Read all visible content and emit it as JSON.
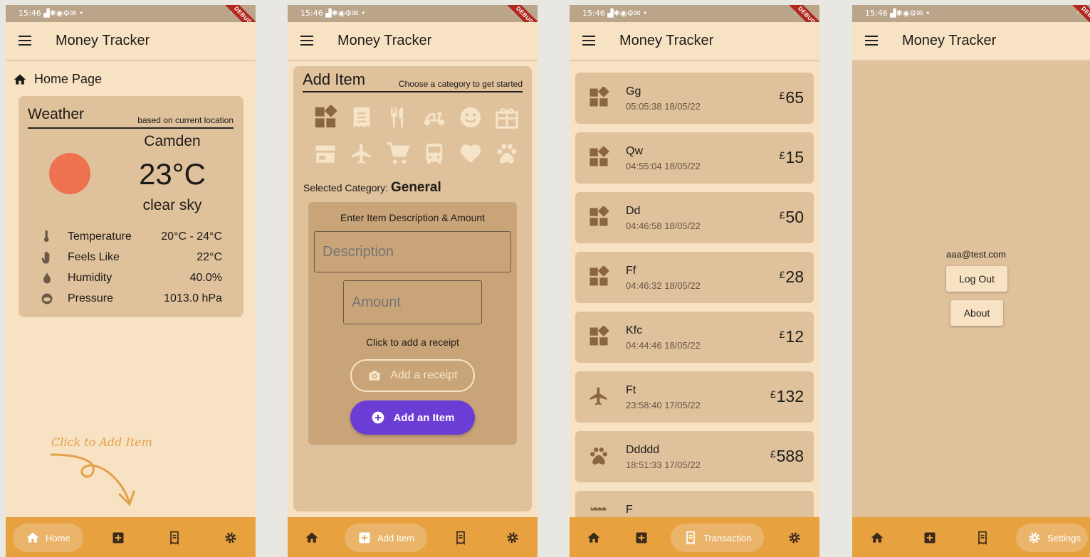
{
  "status_bar": {
    "time": "15:46",
    "icons_left": "▟✱◉⚙✉ •"
  },
  "app": {
    "title": "Money Tracker",
    "debug_label": "DEBUG"
  },
  "nav": {
    "home": "Home",
    "add_item": "Add Item",
    "transaction": "Transaction",
    "settings": "Settings"
  },
  "home": {
    "crumb": "Home Page",
    "weather": {
      "title": "Weather",
      "subtitle": "based on current location",
      "city": "Camden",
      "temp": "23°C",
      "description": "clear sky",
      "rows": [
        {
          "label": "Temperature",
          "value": "20°C - 24°C",
          "icon": "thermometer-icon"
        },
        {
          "label": "Feels Like",
          "value": "22°C",
          "icon": "hand-icon"
        },
        {
          "label": "Humidity",
          "value": "40.0%",
          "icon": "drop-icon"
        },
        {
          "label": "Pressure",
          "value": "1013.0 hPa",
          "icon": "cloud-icon"
        }
      ]
    },
    "hint": "Click to Add Item"
  },
  "add_item": {
    "title": "Add Item",
    "subtitle": "Choose a category to get started",
    "selected_label": "Selected Category:",
    "selected_value": "General",
    "form_title": "Enter Item Description & Amount",
    "description_placeholder": "Description",
    "amount_placeholder": "Amount",
    "receipt_hint": "Click to add a receipt",
    "receipt_button": "Add a receipt",
    "submit_button": "Add an Item"
  },
  "transactions": [
    {
      "name": "Gg",
      "time": "05:05:38 18/05/22",
      "currency": "£",
      "amount": "65",
      "icon": "widgets-icon"
    },
    {
      "name": "Qw",
      "time": "04:55:04 18/05/22",
      "currency": "£",
      "amount": "15",
      "icon": "widgets-icon"
    },
    {
      "name": "Dd",
      "time": "04:46:58 18/05/22",
      "currency": "£",
      "amount": "50",
      "icon": "widgets-icon"
    },
    {
      "name": "Ff",
      "time": "04:46:32 18/05/22",
      "currency": "£",
      "amount": "28",
      "icon": "widgets-icon"
    },
    {
      "name": "Kfc",
      "time": "04:44:46 18/05/22",
      "currency": "£",
      "amount": "12",
      "icon": "widgets-icon"
    },
    {
      "name": "Ft",
      "time": "23:58:40 17/05/22",
      "currency": "£",
      "amount": "132",
      "icon": "airplane-icon"
    },
    {
      "name": "Ddddd",
      "time": "18:51:33 17/05/22",
      "currency": "£",
      "amount": "588",
      "icon": "paw-icon"
    },
    {
      "name": "F",
      "time": "",
      "currency": "",
      "amount": "",
      "icon": "receipt-icon"
    }
  ],
  "settings": {
    "email": "aaa@test.com",
    "logout": "Log Out",
    "about": "About"
  },
  "colors": {
    "background": "#f8e2c4",
    "card": "#dfc19c",
    "navbar": "#e7a13f",
    "accent": "#6c3dd4",
    "sun": "#ee7150",
    "icon_brown": "#8a6541"
  }
}
